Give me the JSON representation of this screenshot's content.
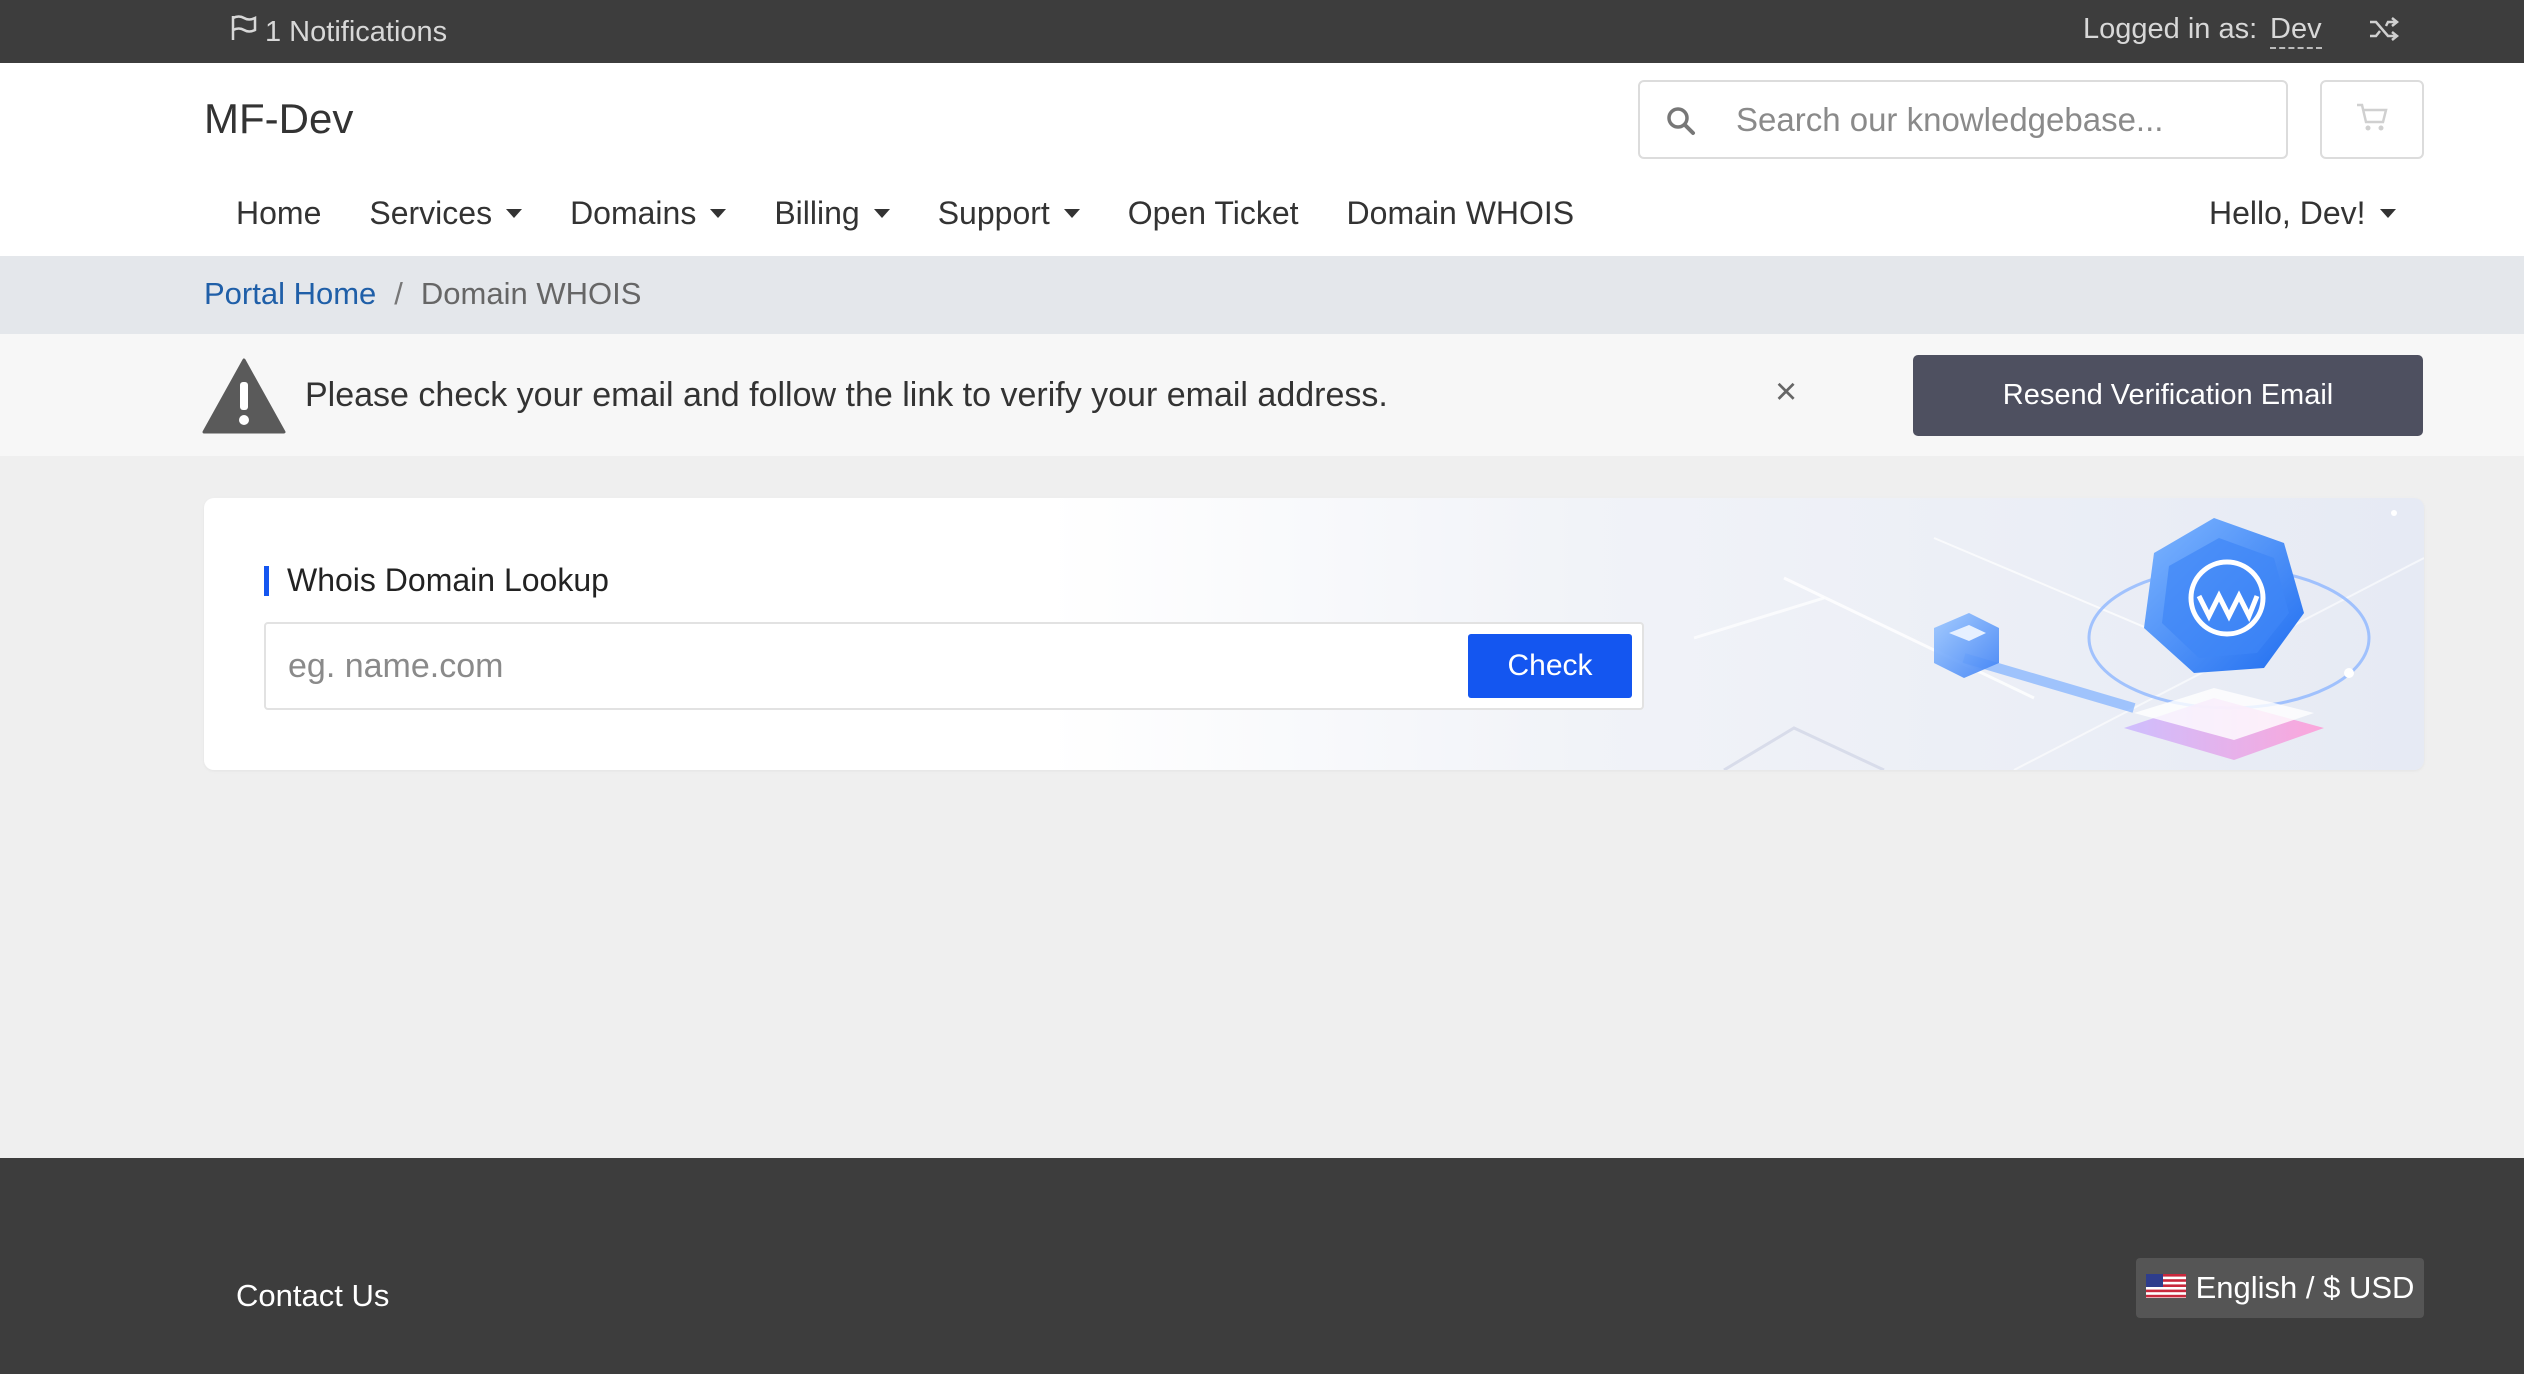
{
  "topbar": {
    "notifications_label": "1 Notifications",
    "logged_in_label": "Logged in as:",
    "user_name": "Dev",
    "flag_icon": "flag-icon",
    "switch_icon": "shuffle-icon"
  },
  "header": {
    "brand": "MF-Dev",
    "search_placeholder": "Search our knowledgebase...",
    "cart_icon": "cart-icon"
  },
  "nav": {
    "items": [
      {
        "label": "Home",
        "dropdown": false
      },
      {
        "label": "Services",
        "dropdown": true
      },
      {
        "label": "Domains",
        "dropdown": true
      },
      {
        "label": "Billing",
        "dropdown": true
      },
      {
        "label": "Support",
        "dropdown": true
      },
      {
        "label": "Open Ticket",
        "dropdown": false
      },
      {
        "label": "Domain WHOIS",
        "dropdown": false
      }
    ],
    "account_label": "Hello, Dev!"
  },
  "breadcrumb": {
    "home": "Portal Home",
    "separator": "/",
    "current": "Domain WHOIS"
  },
  "alert": {
    "message": "Please check your email and follow the link to verify your email address.",
    "close_symbol": "×",
    "button_label": "Resend Verification Email"
  },
  "whois": {
    "title": "Whois Domain Lookup",
    "input_placeholder": "eg. name.com",
    "button_label": "Check",
    "accent_color": "#1456f0"
  },
  "footer": {
    "contact_label": "Contact Us",
    "language_label": "English / $ USD"
  }
}
